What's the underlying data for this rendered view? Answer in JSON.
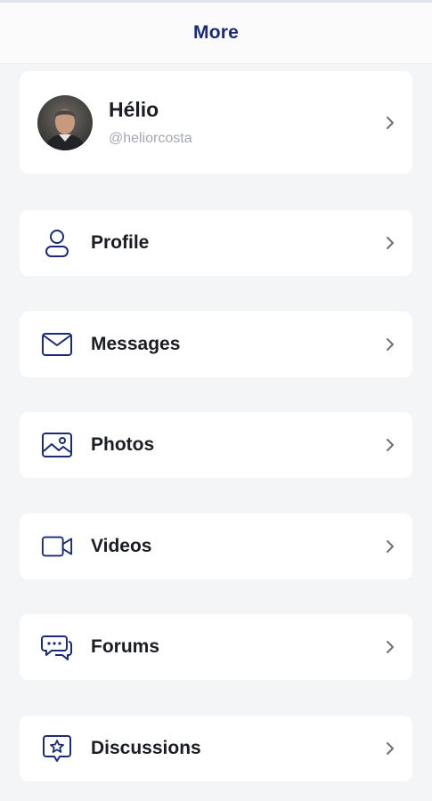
{
  "header": {
    "title": "More"
  },
  "user": {
    "name": "Hélio",
    "handle": "@heliorcosta"
  },
  "menu": [
    {
      "label": "Profile",
      "icon": "person-icon"
    },
    {
      "label": "Messages",
      "icon": "envelope-icon"
    },
    {
      "label": "Photos",
      "icon": "photo-icon"
    },
    {
      "label": "Videos",
      "icon": "video-camera-icon"
    },
    {
      "label": "Forums",
      "icon": "chat-bubbles-icon"
    },
    {
      "label": "Discussions",
      "icon": "discussion-star-icon"
    }
  ],
  "colors": {
    "accent": "#1b2a7a",
    "background": "#f4f5f7",
    "card": "#ffffff",
    "text": "#1a1d24",
    "muted": "#a3a7ae"
  }
}
